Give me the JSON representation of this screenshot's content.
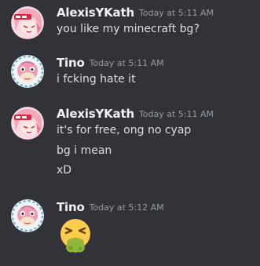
{
  "messages": [
    {
      "author": "AlexisYKath",
      "timestamp": "Today at 5:11 AM",
      "avatar_icon": "anime-girl-avatar-icon",
      "lines": [
        "you like my minecraft bg?"
      ]
    },
    {
      "author": "Tino",
      "timestamp": "Today at 5:11 AM",
      "avatar_icon": "slowpoke-avatar-icon",
      "lines": [
        "i fcking hate it"
      ]
    },
    {
      "author": "AlexisYKath",
      "timestamp": "Today at 5:11 AM",
      "avatar_icon": "anime-girl-avatar-icon",
      "lines": [
        "it's for free, ong no cyap",
        "bg i mean",
        "xD"
      ]
    },
    {
      "author": "Tino",
      "timestamp": "Today at 5:12 AM",
      "avatar_icon": "slowpoke-avatar-icon",
      "emoji": "vomiting-face-emoji-icon"
    }
  ],
  "colors": {
    "background": "#313338",
    "author": "#f2f3f5",
    "timestamp": "#949ba4",
    "text": "#dbdee1"
  }
}
